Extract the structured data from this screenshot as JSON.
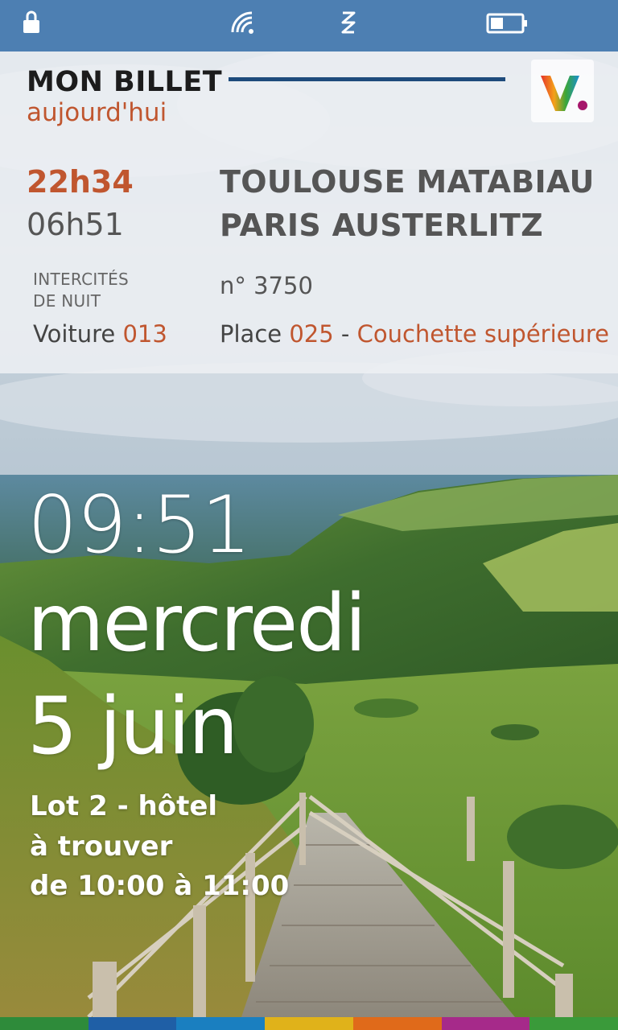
{
  "status_bar": {
    "icons": [
      "lock-icon",
      "wifi-icon",
      "vibrate-icon",
      "battery-icon"
    ]
  },
  "ticket": {
    "title": "MON BILLET",
    "subtitle": "aujourd'hui",
    "departure_time": "22h34",
    "arrival_time": "06h51",
    "from_station": "TOULOUSE MATABIAU",
    "to_station": "PARIS AUSTERLITZ",
    "train_type_line1": "INTERCITÉS",
    "train_type_line2": "DE NUIT",
    "train_number": "n° 3750",
    "coach_label": "Voiture",
    "coach_value": "013",
    "place_label": "Place",
    "place_value": "025",
    "place_separator": " - ",
    "berth": "Couchette supérieure"
  },
  "lock_screen": {
    "time": "09:51",
    "day": "mercredi",
    "date": "5 juin",
    "event_line1": "Lot 2 - hôtel",
    "event_line2": "à trouver",
    "event_line3": "de 10:00 à 11:00"
  },
  "colors": {
    "accent": "#c0562f",
    "status_bar": "#4d7fb2",
    "rule": "#1e4b7c",
    "brand_stripe": [
      "#2e8b3a",
      "#1f5fa6",
      "#1a7fc0",
      "#e0b21a",
      "#e06a1a",
      "#a62a8a",
      "#3a9a3a"
    ]
  }
}
